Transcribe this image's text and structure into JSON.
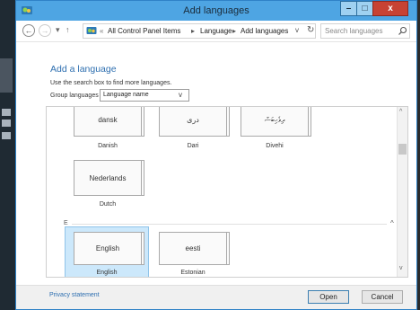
{
  "window": {
    "title": "Add languages",
    "minimize_glyph": "–",
    "maximize_glyph": "□",
    "close_glyph": "x"
  },
  "nav": {
    "back_glyph": "←",
    "forward_glyph": "→",
    "dropdown_glyph": "▾",
    "up_glyph": "↑",
    "overflow_glyph": "«",
    "breadcrumb": [
      "All Control Panel Items",
      "Language",
      "Add languages"
    ],
    "breadcrumb_separator": "▸",
    "address_chevron": "v",
    "refresh_glyph": "↻",
    "search_placeholder": "Search languages"
  },
  "content": {
    "heading": "Add a language",
    "instruction": "Use the search box to find more languages.",
    "group_label": "Group languages by:",
    "group_value": "Language name",
    "group_chevron": "v"
  },
  "languages": [
    {
      "native": "dansk",
      "name": "Danish",
      "selected": false
    },
    {
      "native": "دری",
      "name": "Dari",
      "selected": false
    },
    {
      "native": "ދިވެހިބަސް",
      "name": "Divehi",
      "selected": false
    },
    {
      "native": "Nederlands",
      "name": "Dutch",
      "selected": false
    },
    {
      "native": "English",
      "name": "English",
      "selected": true
    },
    {
      "native": "eesti",
      "name": "Estonian",
      "selected": false
    }
  ],
  "groups": [
    {
      "letter": "E",
      "chevron": "^"
    }
  ],
  "scrollbar": {
    "up_glyph": "^",
    "down_glyph": "v"
  },
  "footer": {
    "privacy": "Privacy statement",
    "open": "Open",
    "cancel": "Cancel"
  },
  "colors": {
    "titlebar": "#4ea5e3",
    "accent_link": "#2e6fb0",
    "selection": "#cce8fb",
    "close_button": "#c74233"
  }
}
